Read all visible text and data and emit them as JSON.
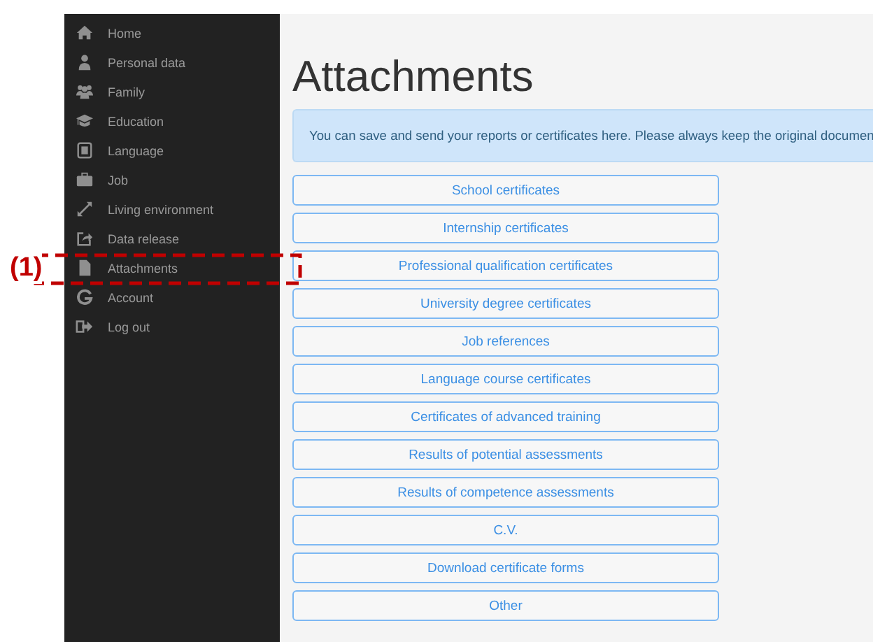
{
  "sidebar": {
    "items": [
      {
        "label": "Home"
      },
      {
        "label": "Personal data"
      },
      {
        "label": "Family"
      },
      {
        "label": "Education"
      },
      {
        "label": "Language"
      },
      {
        "label": "Job"
      },
      {
        "label": "Living environment"
      },
      {
        "label": "Data release"
      },
      {
        "label": "Attachments"
      },
      {
        "label": "Account"
      },
      {
        "label": "Log out"
      }
    ]
  },
  "page": {
    "title": "Attachments",
    "info": "You can save and send your reports or certificates here. Please always keep the original documen",
    "buttons": [
      "School certificates",
      "Internship certificates",
      "Professional qualification certificates",
      "University degree certificates",
      "Job references",
      "Language course certificates",
      "Certificates of advanced training",
      "Results of potential assessments",
      "Results of competence assessments",
      "C.V.",
      "Download certificate forms",
      "Other"
    ]
  },
  "annotation": {
    "label": "(1)"
  }
}
